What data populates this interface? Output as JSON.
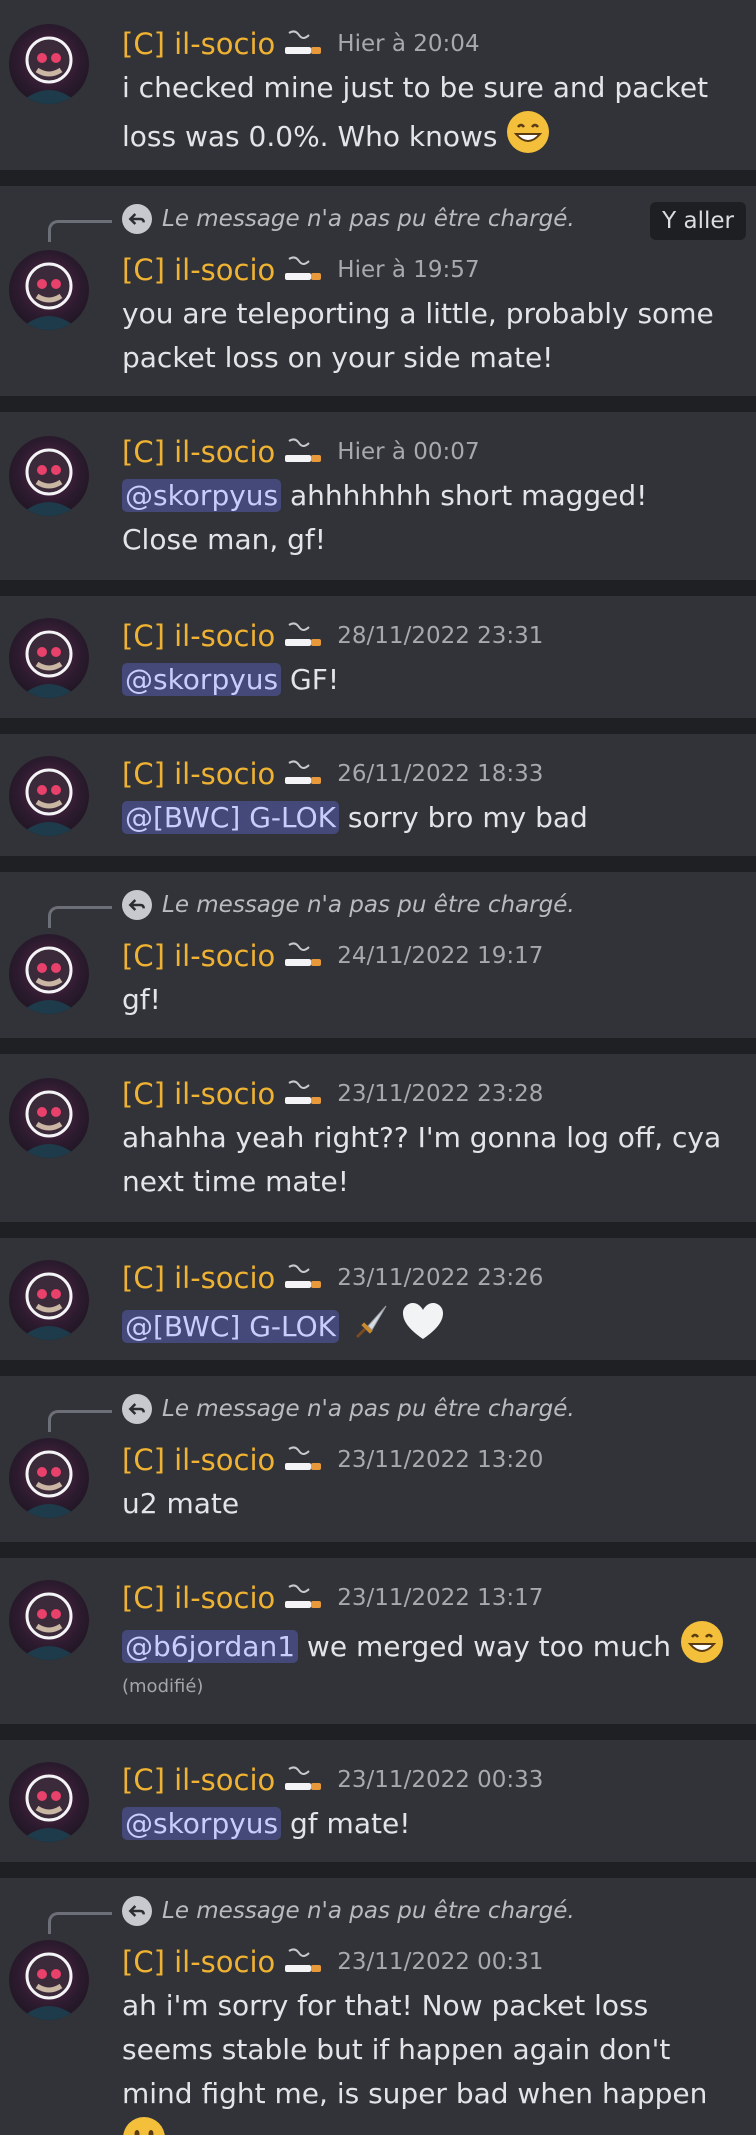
{
  "author": "[C] il-socio",
  "reply_fallback": "Le message n'a pas pu être chargé.",
  "goto_label": "Y aller",
  "edited_label": "(modifié)",
  "messages": [
    {
      "ts": "Hier à 20:04",
      "parts": [
        "i checked mine just to be sure and packet loss was 0.0%. Who knows "
      ]
    },
    {
      "ts": "Hier à 19:57",
      "parts": [
        "you are teleporting a little, probably some packet loss on your side mate!"
      ]
    },
    {
      "ts": "Hier à 00:07",
      "mention": "@skorpyus",
      "parts": [
        " ahhhhhhh short magged! Close man, gf!"
      ]
    },
    {
      "ts": "28/11/2022 23:31",
      "mention": "@skorpyus",
      "parts": [
        " GF!"
      ]
    },
    {
      "ts": "26/11/2022 18:33",
      "mention": "@[BWC] G-LOK",
      "parts": [
        " sorry bro my bad"
      ]
    },
    {
      "ts": "24/11/2022 19:17",
      "parts": [
        "gf!"
      ]
    },
    {
      "ts": "23/11/2022 23:28",
      "parts": [
        "ahahha yeah right?? I'm gonna log off, cya next time mate!"
      ]
    },
    {
      "ts": "23/11/2022 23:26",
      "mention": "@[BWC] G-LOK",
      "parts": [
        " "
      ]
    },
    {
      "ts": "23/11/2022 13:20",
      "parts": [
        "u2 mate"
      ]
    },
    {
      "ts": "23/11/2022 13:17",
      "mention": "@b6jordan1",
      "parts": [
        " we merged way too much "
      ]
    },
    {
      "ts": "23/11/2022 00:33",
      "mention": "@skorpyus",
      "parts": [
        " gf mate!"
      ]
    },
    {
      "ts": "23/11/2022 00:31",
      "parts": [
        "ah i'm sorry for that! Now packet loss seems stable but if happen again don't mind fight me, is super bad when happen "
      ]
    }
  ]
}
